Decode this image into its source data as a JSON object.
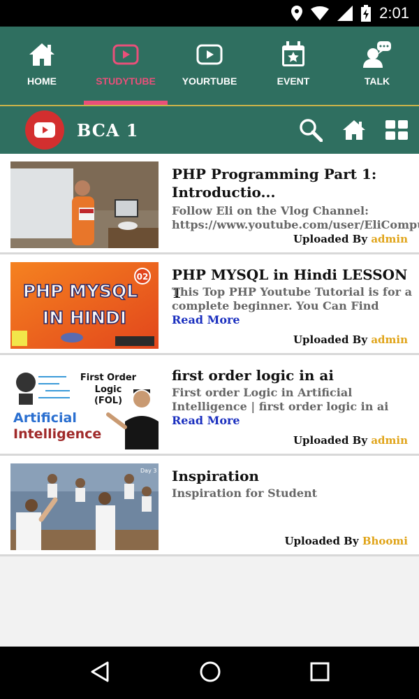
{
  "status_bar": {
    "time": "2:01"
  },
  "tabs": [
    {
      "label": "HOME",
      "icon": "home-icon",
      "active": false
    },
    {
      "label": "STUDYTUBE",
      "icon": "play-button-icon",
      "active": true
    },
    {
      "label": "YOURTUBE",
      "icon": "play-button-icon",
      "active": false
    },
    {
      "label": "EVENT",
      "icon": "calendar-star-icon",
      "active": false
    },
    {
      "label": "TALK",
      "icon": "chat-person-icon",
      "active": false
    }
  ],
  "header": {
    "title": "BCA  1",
    "icons": [
      "youtube-logo-icon",
      "search-icon",
      "home-icon",
      "grid-icon"
    ]
  },
  "videos": [
    {
      "title": "PHP Programming Part 1: Introductio...",
      "description": "Follow Eli on the Vlog Channel: https://www.youtube.com/user/EliCompu.",
      "read_more": "",
      "uploaded_by_label": "Uploaded By",
      "uploader": "admin"
    },
    {
      "title": "PHP MYSQL in Hindi LESSON 1",
      "description": "This Top PHP Youtube Tutorial is for a complete beginner. You Can Find",
      "read_more": "Read More",
      "uploaded_by_label": "Uploaded By",
      "uploader": "admin",
      "thumb_text": {
        "line1": "PHP MYSQL",
        "line2": "IN HINDI",
        "badge": "02"
      }
    },
    {
      "title": "first order logic in ai",
      "description": "First order Logic in Artificial Intelligence | first order logic in ai",
      "read_more": "Read More",
      "uploaded_by_label": "Uploaded By",
      "uploader": "admin",
      "thumb_text": {
        "top1": "First Order",
        "top2": "Logic",
        "top3": "(FOL)",
        "bottom1": "Artificial",
        "bottom2": "Intelligence"
      }
    },
    {
      "title": "Inspiration",
      "description": "Inspiration for Student",
      "read_more": "",
      "uploaded_by_label": "Uploaded By",
      "uploader": "Bhoomi",
      "thumb_text": {
        "corner": "Day 3"
      }
    }
  ],
  "colors": {
    "nav_bg": "#2f6f60",
    "active_tab": "#e9507a",
    "uploader_name": "#e0a419",
    "read_more": "#1a2fbf",
    "youtube_red": "#d32f2f"
  }
}
